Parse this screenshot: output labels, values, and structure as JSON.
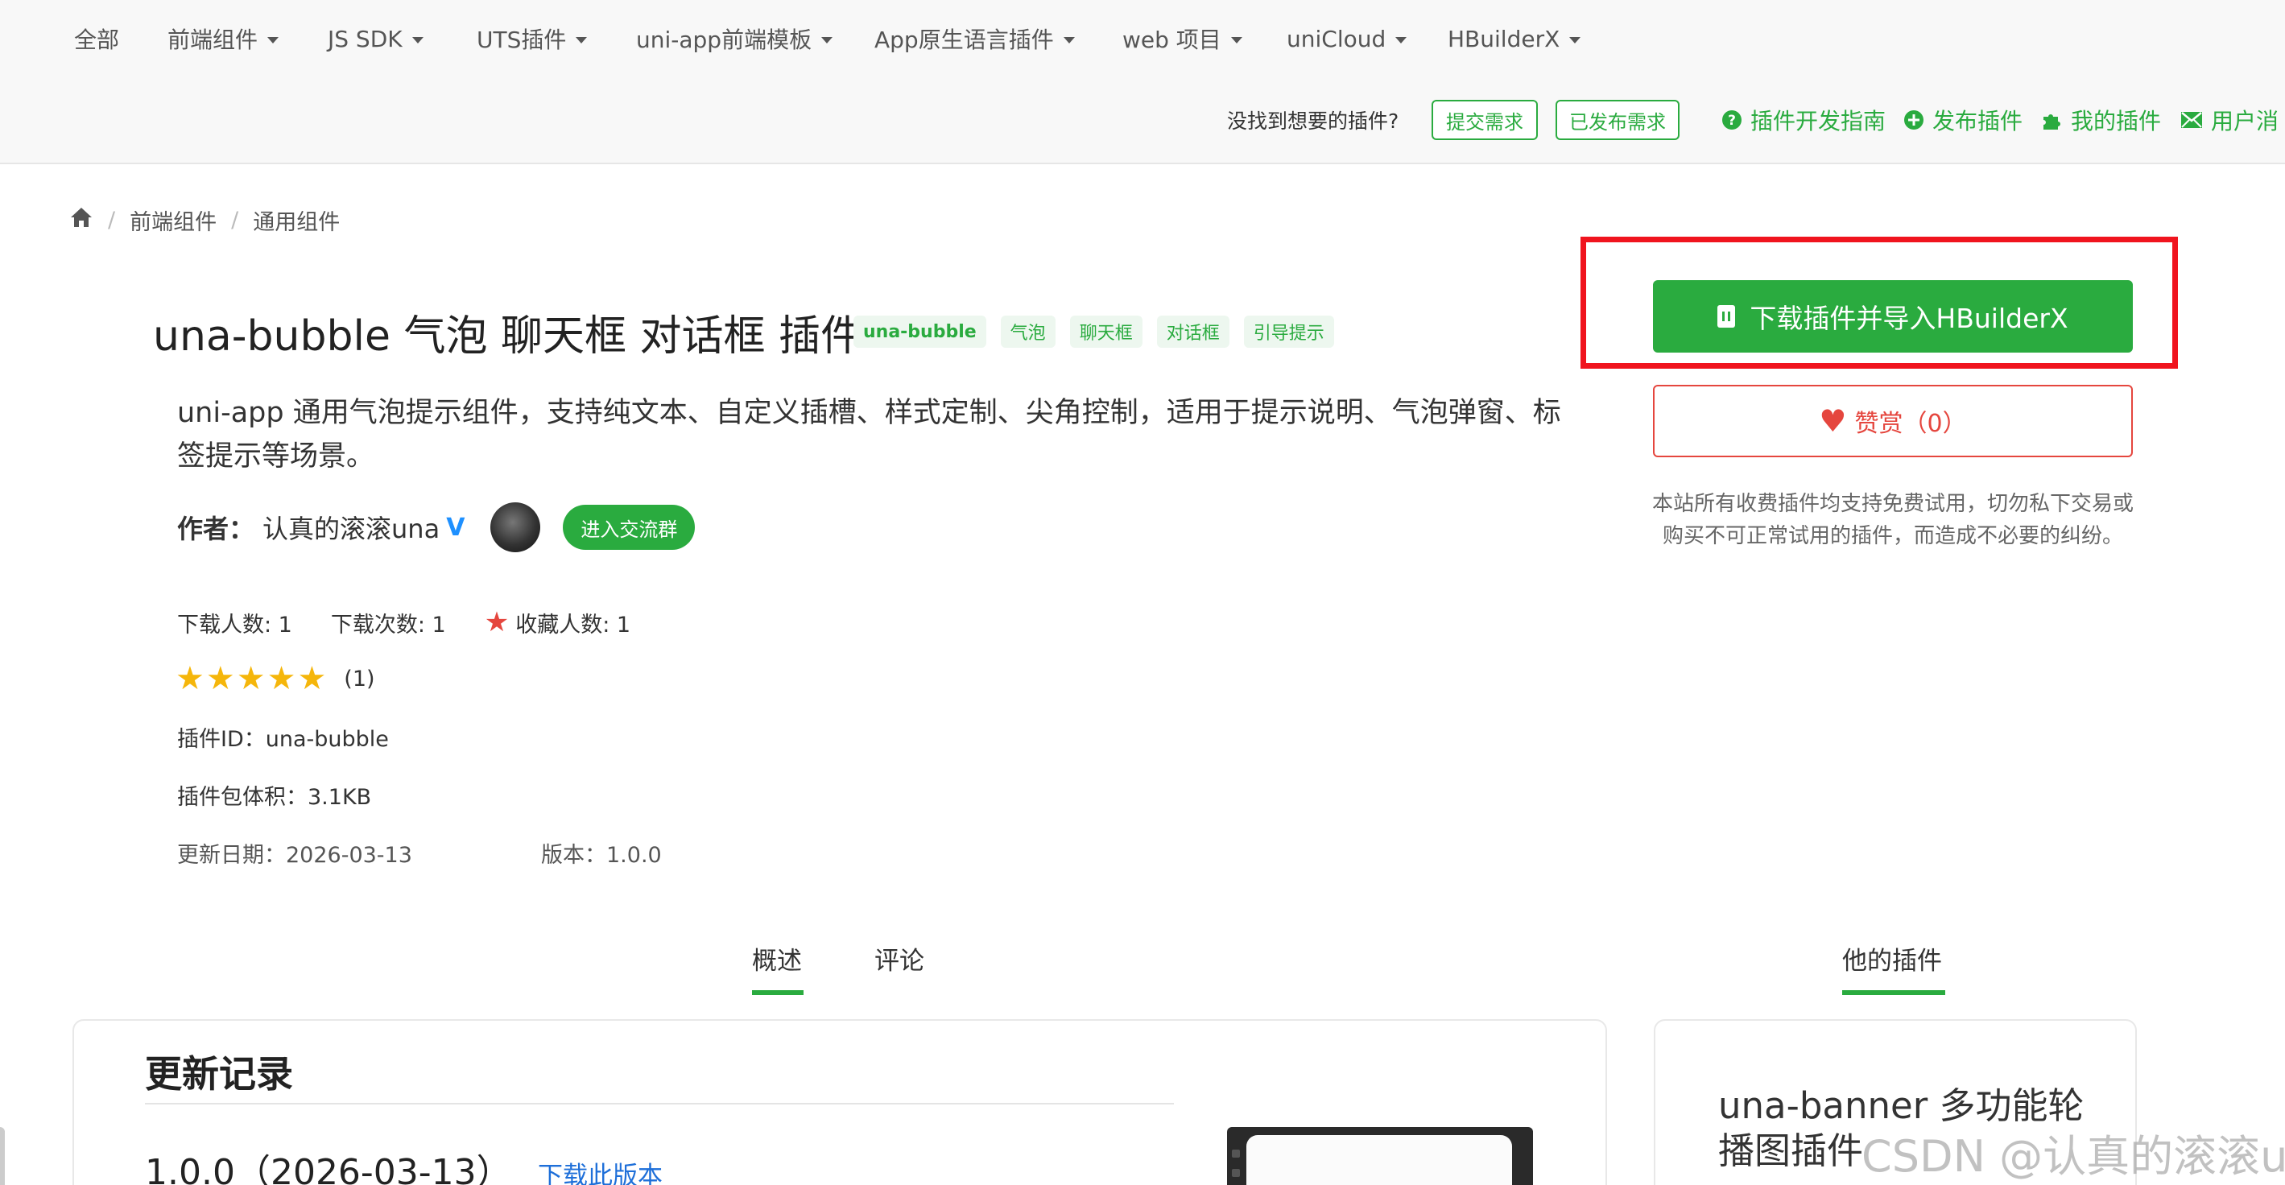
{
  "topnav": {
    "items": [
      {
        "label": "全部",
        "dropdown": false
      },
      {
        "label": "前端组件",
        "dropdown": true
      },
      {
        "label": "JS SDK",
        "dropdown": true
      },
      {
        "label": "UTS插件",
        "dropdown": true
      },
      {
        "label": "uni-app前端模板",
        "dropdown": true
      },
      {
        "label": "App原生语言插件",
        "dropdown": true
      },
      {
        "label": "web 项目",
        "dropdown": true
      },
      {
        "label": "uniCloud",
        "dropdown": true
      },
      {
        "label": "HBuilderX",
        "dropdown": true
      }
    ],
    "prompt": "没找到想要的插件?",
    "submit_request": "提交需求",
    "published_request": "已发布需求",
    "links": [
      {
        "label": "插件开发指南",
        "icon": "question-circle-icon"
      },
      {
        "label": "发布插件",
        "icon": "plus-circle-icon"
      },
      {
        "label": "我的插件",
        "icon": "puzzle-icon"
      },
      {
        "label": "用户消",
        "icon": "mail-icon"
      }
    ]
  },
  "breadcrumb": {
    "home_icon": "home-icon",
    "items": [
      "前端组件",
      "通用组件"
    ]
  },
  "plugin": {
    "title": "una-bubble 气泡 聊天框 对话框 插件",
    "tags": [
      "una-bubble",
      "气泡",
      "聊天框",
      "对话框",
      "引导提示"
    ],
    "description": "uni-app 通用气泡提示组件，支持纯文本、自定义插槽、样式定制、尖角控制，适用于提示说明、气泡弹窗、标签提示等场景。",
    "author_label": "作者：",
    "author_name": "认真的滚滚una",
    "verified_mark": "V",
    "join_group": "进入交流群",
    "downloads_users": "下载人数: 1",
    "downloads_times": "下载次数: 1",
    "favorites": "收藏人数: 1",
    "rating_stars": 5,
    "rating_count": "(1)",
    "plugin_id": "插件ID：una-bubble",
    "package_size": "插件包体积：3.1KB",
    "updated": "更新日期：2026-03-13",
    "version": "版本：1.0.0"
  },
  "sidebar": {
    "download_button": "下载插件并导入HBuilderX",
    "like_button": "赞赏（0）",
    "notice": "本站所有收费插件均支持免费试用，切勿私下交易或购买不可正常试用的插件，而造成不必要的纠纷。"
  },
  "tabs": {
    "overview": "概述",
    "comments": "评论",
    "his_plugins": "他的插件"
  },
  "changelog": {
    "title": "更新记录",
    "version_heading": "1.0.0（2026-03-13）",
    "download_version": "下载此版本"
  },
  "other_plugin": {
    "title": "una-banner 多功能轮播图插件"
  },
  "watermark": "CSDN @认真的滚滚una",
  "colors": {
    "accent": "#2aab3f",
    "highlight": "#f0141e",
    "like": "#e5463e",
    "star": "#f5b60b",
    "link": "#1e6fd9"
  }
}
